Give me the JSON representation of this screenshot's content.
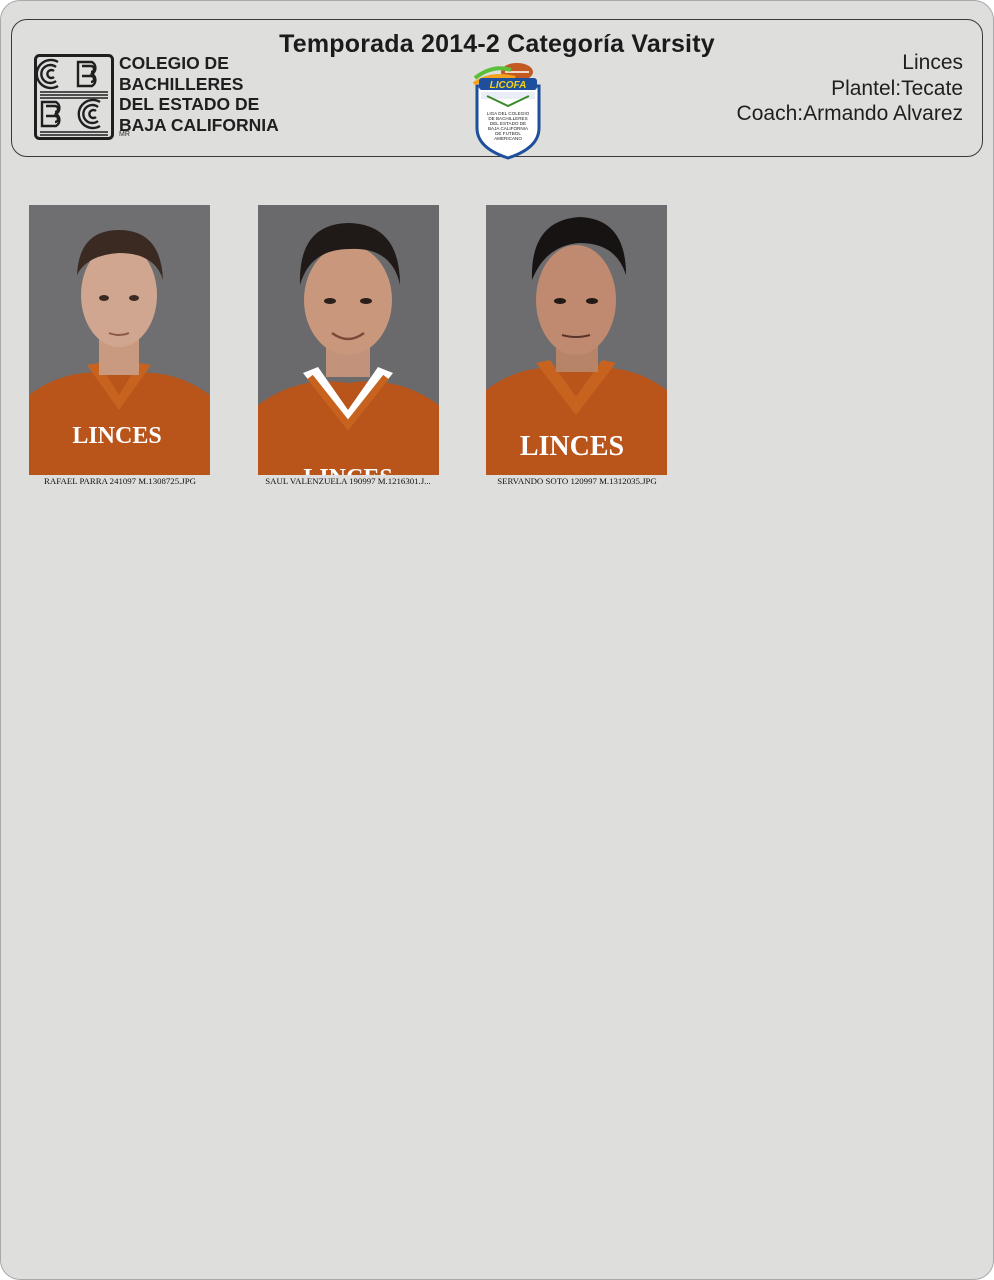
{
  "header": {
    "title": "Temporada 2014-2 Categoría Varsity",
    "school_logo_lines": [
      "COLEGIO DE",
      "BACHILLERES",
      "DEL ESTADO DE",
      "BAJA CALIFORNIA"
    ],
    "school_logo_mark": "MR",
    "league_logo_name": "LICOFA",
    "league_logo_lines": [
      "LIGA DEL COLEGIO",
      "DE BACHILLERES",
      "DEL ESTADO DE",
      "BAJA CALIFORNIA",
      "DE FUTBOL",
      "AMERICANO"
    ],
    "team": "Linces",
    "campus": "Plantel:Tecate",
    "coach": "Coach:Armando Alvarez"
  },
  "players": [
    {
      "caption": "RAFAEL PARRA 241097 M.1308725.JPG",
      "jersey_text": "LINCES"
    },
    {
      "caption": "SAUL VALENZUELA 190997 M.1216301.J...",
      "jersey_text": "LINCES"
    },
    {
      "caption": "SERVANDO SOTO 120997 M.1312035.JPG",
      "jersey_text": "LINCES"
    }
  ],
  "colors": {
    "page_background": "#dededd",
    "jersey_orange": "#b9541b",
    "photo_background": "#6d6d6f"
  }
}
